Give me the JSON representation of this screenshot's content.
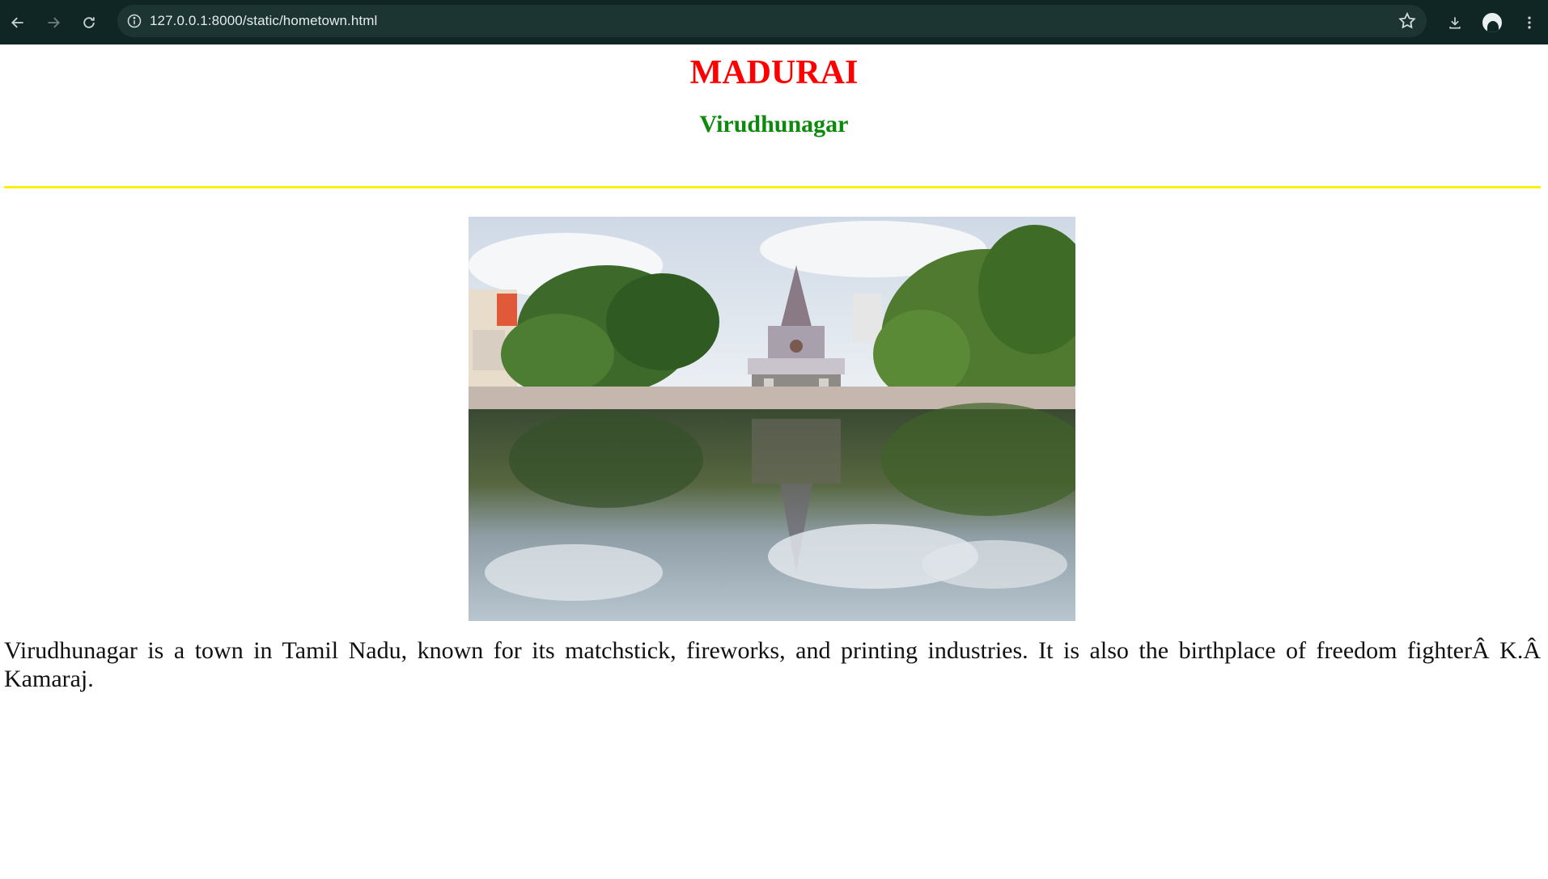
{
  "browser": {
    "url": "127.0.0.1:8000/static/hometown.html",
    "icons": [
      "back-arrow-icon",
      "forward-arrow-icon",
      "reload-icon",
      "site-info-icon",
      "bookmark-star-icon",
      "download-icon",
      "profile-avatar-icon",
      "menu-kebab-icon"
    ]
  },
  "page": {
    "title": "MADURAI",
    "subtitle": "Virudhunagar",
    "description": "Virudhunagar is a town in Tamil Nadu, known for its matchstick, fireworks, and printing industries. It is also the birthplace of freedom fighterÂ K.Â Kamaraj.",
    "colors": {
      "title": "#ff0000",
      "subtitle": "#0c8a0c",
      "divider": "#f7f10f",
      "browser_bar": "#102624"
    }
  }
}
